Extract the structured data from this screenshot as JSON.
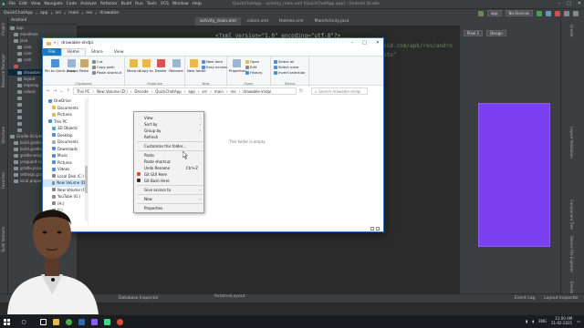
{
  "as": {
    "title": "QuickChatApp - activity_main.xml [QuickChatApp.app] - Android Studio",
    "menu": [
      "File",
      "Edit",
      "View",
      "Navigate",
      "Code",
      "Analyze",
      "Refactor",
      "Build",
      "Run",
      "Tools",
      "VCS",
      "Window",
      "Help"
    ],
    "breadcrumbs": [
      "QuickChatApp",
      "app",
      "src",
      "main",
      "res",
      "drawable"
    ],
    "toolbar": {
      "config": "app",
      "device": "No Devices"
    },
    "project_header": "Android",
    "tree": [
      "app",
      "manifests",
      "java",
      "com",
      "com",
      "com",
      "drawable",
      "layout",
      "mipmap",
      "values",
      "Gradle Scripts",
      "build.gradle",
      "build.gradle",
      "gradle-wrapper",
      "proguard-rules.pro",
      "gradle.properties",
      "settings.gradle",
      "local.properties"
    ],
    "tabs": [
      "activity_main.xml",
      "colors.xml",
      "themes.xml",
      "MainActivity.java"
    ],
    "code": [
      "<?xml version=\"1.0\" encoding=\"utf-8\"?>",
      "oid.com/apk/res/andro",
      "uto\""
    ],
    "preview": {
      "device": "Pixel 2",
      "theme": "Design"
    },
    "left_tabs": [
      "Project",
      "Resource Manager",
      "Structure",
      "Favorites",
      "Build Variants"
    ],
    "right_tabs": [
      "Gradle",
      "Layout Validation",
      "Component Tree",
      "Device File Explorer",
      "Emulator"
    ],
    "status": {
      "left": "Database Inspector",
      "layout": "RelativeLayout",
      "event_log": "Event Log",
      "layout_inspector": "Layout Inspector"
    }
  },
  "explorer": {
    "title": "drawable-xhdpi",
    "ribbon_tabs": [
      "File",
      "Home",
      "Share",
      "View"
    ],
    "clipboard": {
      "pin": "Pin to Quick access",
      "copy": "Copy",
      "paste": "Paste",
      "cut": "Cut",
      "copy_path": "Copy path",
      "paste_shortcut": "Paste shortcut",
      "label": "Clipboard"
    },
    "organize": {
      "move": "Move to",
      "copy_to": "Copy to",
      "delete": "Delete",
      "rename": "Rename",
      "label": "Organize"
    },
    "new": {
      "new_folder": "New folder",
      "new_item": "New item",
      "easy_access": "Easy access",
      "label": "New"
    },
    "open": {
      "properties": "Properties",
      "open": "Open",
      "edit": "Edit",
      "history": "History",
      "label": "Open"
    },
    "select": {
      "select_all": "Select all",
      "select_none": "Select none",
      "invert": "Invert selection",
      "label": "Select"
    },
    "path": [
      "This PC",
      "New Volume (D:)",
      "Decode",
      "QuickChatApp",
      "app",
      "src",
      "main",
      "res",
      "drawable-xhdpi"
    ],
    "search_placeholder": "Search drawable-xhdpi",
    "empty_text": "This folder is empty.",
    "nav": [
      "OneDrive",
      "Documents",
      "Pictures",
      "This PC",
      "3D Objects",
      "Desktop",
      "Documents",
      "Downloads",
      "Music",
      "Pictures",
      "Videos",
      "Local Disk (C:)",
      "New Volume (D:)",
      "New Volume (F:)",
      "YouTube (G:)",
      "(H:)",
      "(I:)"
    ],
    "status": "0 items"
  },
  "context_menu": {
    "items": [
      "View",
      "Sort by",
      "Group by",
      "Refresh",
      "Customize this folder...",
      "Paste",
      "Paste shortcut",
      "Undo Rename",
      "Git GUI Here",
      "Git Bash Here",
      "Give access to",
      "New",
      "Properties"
    ],
    "undo_shortcut": "Ctrl+Z"
  },
  "taskbar": {
    "time": "11:00 AM",
    "date": "21-02-2021",
    "lang": "ENG"
  },
  "colors": {
    "accent": "#1979ca",
    "phone": "#7a3ff0",
    "as_bg": "#2b2b2b",
    "as_panel": "#3c3f41"
  }
}
